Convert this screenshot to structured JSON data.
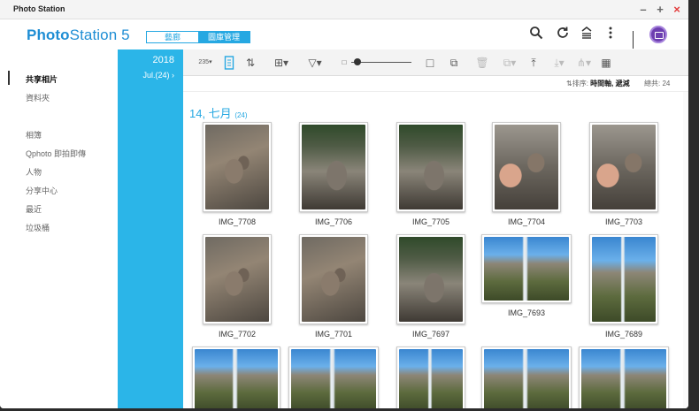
{
  "window": {
    "title": "Photo Station"
  },
  "window_controls": [
    "–",
    "+",
    "×"
  ],
  "header": {
    "logo_bold": "Photo",
    "logo_rest": "Station 5",
    "toggle": {
      "inactive": "藝廊",
      "active": "圖庫管理"
    },
    "icons": [
      "search-icon",
      "refresh-icon",
      "upload-queue-icon",
      "more-icon",
      "user-avatar"
    ]
  },
  "sidebar": {
    "items": [
      {
        "label": "共享相片",
        "selected": true
      },
      {
        "label": "資料夾"
      },
      {
        "label": "相簿"
      },
      {
        "label": "Qphoto 即拍即傳"
      },
      {
        "label": "人物"
      },
      {
        "label": "分享中心"
      },
      {
        "label": "最近"
      },
      {
        "label": "垃圾桶"
      }
    ]
  },
  "timeline": {
    "year": "2018",
    "month": "Jul.(24)",
    "arrow": "›"
  },
  "toolbar": {
    "icons": [
      "photo-filter-icon",
      "info-panel-icon",
      "sort-icon",
      "add-icon",
      "filter-icon",
      "small-size-icon",
      "large-size-icon",
      "multi-select-icon",
      "delete-icon",
      "copy-icon",
      "upload-icon",
      "download-icon",
      "share-icon",
      "qr-code-icon"
    ],
    "filter_label": "235",
    "thumbnail_size": 0.1
  },
  "sortbar": {
    "sort_label": "排序:",
    "sort_value": "時間軸, 遞減",
    "total_label": "總共:",
    "total_value": "24"
  },
  "group": {
    "title": "14, 七月",
    "count": "(24)"
  },
  "photos": [
    {
      "name": "IMG_7708",
      "kind": "squirrel"
    },
    {
      "name": "IMG_7706",
      "kind": "rock"
    },
    {
      "name": "IMG_7705",
      "kind": "rock"
    },
    {
      "name": "IMG_7704",
      "kind": "hand"
    },
    {
      "name": "IMG_7703",
      "kind": "hand"
    },
    {
      "name": "IMG_7702",
      "kind": "squirrel"
    },
    {
      "name": "IMG_7701",
      "kind": "squirrel"
    },
    {
      "name": "IMG_7697",
      "kind": "rock"
    },
    {
      "name": "IMG_7693",
      "kind": "falls"
    },
    {
      "name": "IMG_7689",
      "kind": "falls"
    },
    {
      "name": "",
      "kind": "falls"
    },
    {
      "name": "",
      "kind": "falls"
    },
    {
      "name": "",
      "kind": "falls"
    },
    {
      "name": "",
      "kind": "falls"
    },
    {
      "name": "",
      "kind": "falls"
    }
  ],
  "colors": {
    "accent": "#26a8e2",
    "timeline_bg": "#2bb5e8",
    "close": "#e23b3b"
  }
}
